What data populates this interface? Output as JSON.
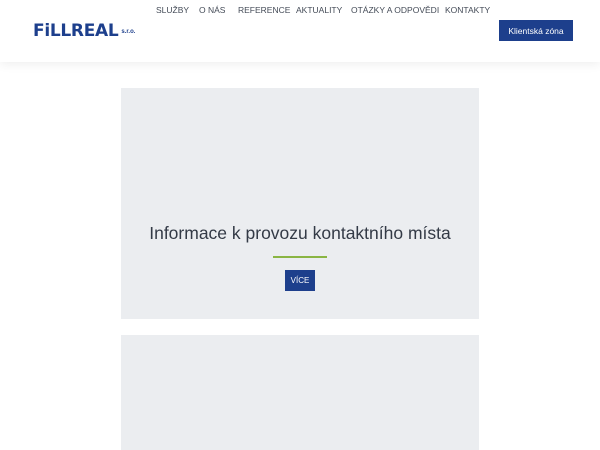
{
  "header": {
    "logo": {
      "text": "FiLLREAL",
      "suffix": "s.r.o."
    },
    "nav": [
      {
        "label": "SLUŽBY"
      },
      {
        "label": "O NÁS"
      },
      {
        "label": "REFERENCE"
      },
      {
        "label": "AKTUALITY"
      },
      {
        "label": "OTÁZKY A ODPOVĚDI"
      },
      {
        "label": "KONTAKTY"
      }
    ],
    "cta_label": "Klientská zóna"
  },
  "hero": {
    "title": "Informace k provozu kontaktního místa",
    "button_label": "VÍCE"
  },
  "colors": {
    "brand": "#1d3f8c",
    "accent": "#8ab543",
    "panel": "#ebedf0"
  }
}
